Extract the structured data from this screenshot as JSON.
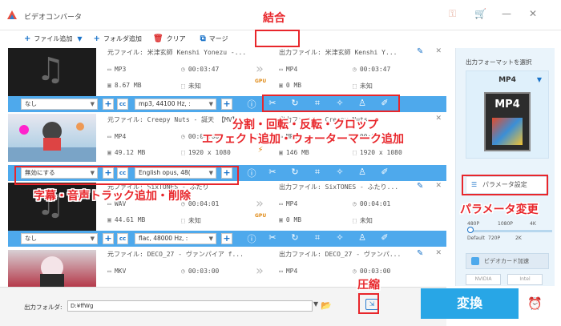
{
  "app": {
    "title": "ビデオコンバータ"
  },
  "toolbar": {
    "add_file": "ファイル追加",
    "add_folder": "フォルダ追加",
    "clear": "クリア",
    "merge": "マージ"
  },
  "rows": [
    {
      "src_label": "元ファイル:",
      "src_name": "米津玄師 Kenshi Yonezu -...",
      "src_format": "MP3",
      "src_duration": "00:03:47",
      "src_size": "8.67 MB",
      "src_res": "未知",
      "out_label": "出力ファイル:",
      "out_name": "米津玄師 Kenshi Y...",
      "out_format": "MP4",
      "out_duration": "00:03:47",
      "out_size": "0 MB",
      "out_res": "未知",
      "subtitle": "なし",
      "audio": "mp3, 44100 Hz, :",
      "gpu": "GPU"
    },
    {
      "src_label": "元ファイル:",
      "src_name": "Creepy Nuts - 誕天 【MV】",
      "src_format": "MP4",
      "src_duration": "00:04:00",
      "src_size": "49.12 MB",
      "src_res": "1920 x 1080",
      "out_label": "出力ファイル:",
      "out_name": "Creepy Nuts...",
      "out_format": "MP4",
      "out_duration": "00:04:00",
      "out_size": "146 MB",
      "out_res": "1920 x 1080",
      "subtitle": "無効にする",
      "audio": "English opus, 48(",
      "gpu": ""
    },
    {
      "src_label": "元ファイル:",
      "src_name": "SixTONES - ふたり",
      "src_format": "WAV",
      "src_duration": "00:04:01",
      "src_size": "44.61 MB",
      "src_res": "未知",
      "out_label": "出力ファイル:",
      "out_name": "SixTONES - ふたり...",
      "out_format": "MP4",
      "out_duration": "00:04:01",
      "out_size": "0 MB",
      "out_res": "未知",
      "subtitle": "なし",
      "audio": "flac, 48000 Hz, :",
      "gpu": "GPU"
    },
    {
      "src_label": "元ファイル:",
      "src_name": "DECO_27 - ヴァンパイア f...",
      "src_format": "MKV",
      "src_duration": "00:03:00",
      "src_size": "",
      "src_res": "",
      "out_label": "出力ファイル:",
      "out_name": "DECO_27 - ヴァンパ...",
      "out_format": "MP4",
      "out_duration": "00:03:00",
      "out_size": "",
      "out_res": "",
      "subtitle": "",
      "audio": "",
      "gpu": ""
    }
  ],
  "output": {
    "folder_label": "出力フォルダ:",
    "folder_path": "D:¥ffWg",
    "convert": "変換"
  },
  "panel": {
    "title": "出力フォーマットを選択",
    "format": "MP4",
    "tile": "MP4",
    "param_btn": "パラメータ設定",
    "quality_top": [
      "480P",
      "1080P",
      "4K"
    ],
    "quality_bottom": [
      "Default",
      "720P",
      "2K"
    ],
    "quality_level": 0.0,
    "hw_accel": "ビデオカード加速",
    "vendor_nvidia": "NVIDIA",
    "vendor_intel": "Intel"
  },
  "annotations": {
    "merge": "結合",
    "edit": "分割・回転・反転・クロップ",
    "edit2": "エフェクト追加・ウォーターマーク追加",
    "track": "字幕・音声トラック追加・削除",
    "param": "パラメータ変更",
    "compress": "圧縮"
  },
  "colors": {
    "accent": "#28a6e6",
    "edit_bar": "#4ea9ec",
    "annotation": "#e8262b"
  }
}
